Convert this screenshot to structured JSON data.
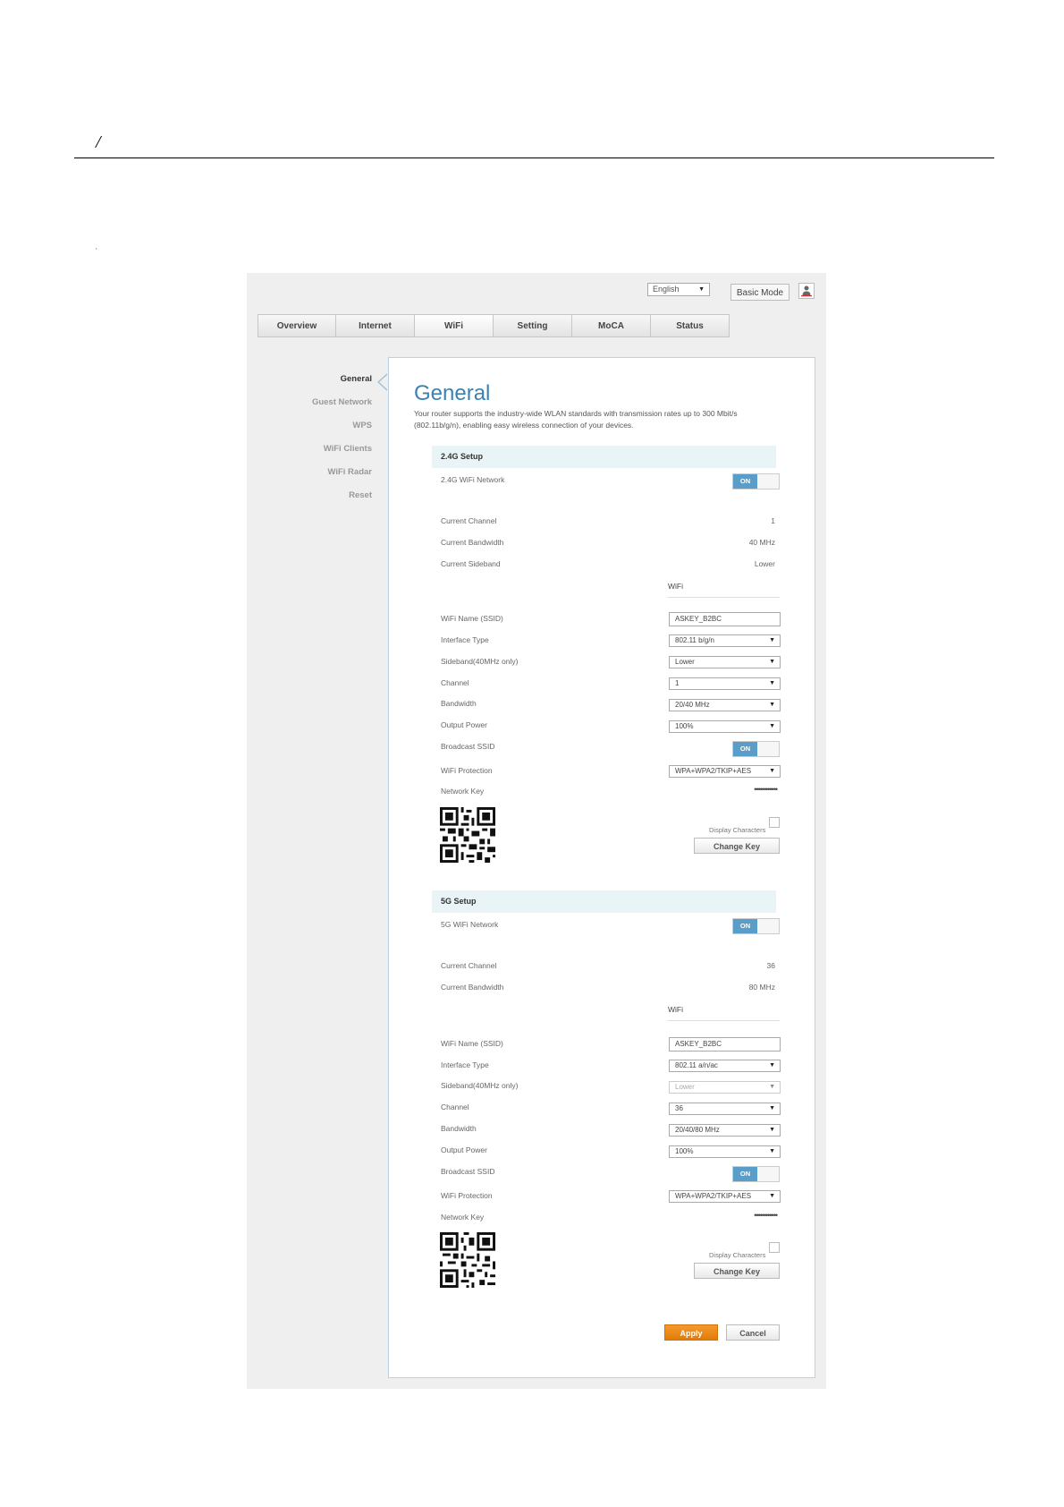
{
  "doc": {
    "mark": "/",
    "tick": "'"
  },
  "header": {
    "language": "English",
    "basic_mode": "Basic Mode",
    "user_icon": "user-icon"
  },
  "tabs": [
    {
      "label": "Overview"
    },
    {
      "label": "Internet"
    },
    {
      "label": "WiFi"
    },
    {
      "label": "Setting"
    },
    {
      "label": "MoCA"
    },
    {
      "label": "Status"
    }
  ],
  "active_tab": "WiFi",
  "sidebar": {
    "items": [
      {
        "label": "General"
      },
      {
        "label": "Guest Network"
      },
      {
        "label": "WPS"
      },
      {
        "label": "WiFi Clients"
      },
      {
        "label": "WiFi Radar"
      },
      {
        "label": "Reset"
      }
    ],
    "active": "General"
  },
  "main": {
    "title": "General",
    "description": "Your router supports the industry-wide WLAN standards with transmission rates up to 300 Mbit/s (802.11b/g/n), enabling easy wireless connection of your devices."
  },
  "band24": {
    "header": "2.4G Setup",
    "network_label": "2.4G WiFi Network",
    "network_toggle": "ON",
    "current_channel_label": "Current Channel",
    "current_channel": "1",
    "current_bandwidth_label": "Current Bandwidth",
    "current_bandwidth": "40 MHz",
    "current_sideband_label": "Current Sideband",
    "current_sideband": "Lower",
    "wifi_subheader": "WiFi",
    "ssid_label": "WiFi Name (SSID)",
    "ssid": "ASKEY_B2BC",
    "interface_label": "Interface Type",
    "interface": "802.11 b/g/n",
    "sideband_label": "Sideband(40MHz only)",
    "sideband": "Lower",
    "channel_label": "Channel",
    "channel": "1",
    "bandwidth_label": "Bandwidth",
    "bandwidth": "20/40 MHz",
    "power_label": "Output Power",
    "power": "100%",
    "broadcast_label": "Broadcast SSID",
    "broadcast_toggle": "ON",
    "protection_label": "WiFi Protection",
    "protection": "WPA+WPA2/TKIP+AES",
    "key_label": "Network Key",
    "key_mask": "••••••••••••",
    "display_chars": "Display Characters",
    "change_key": "Change Key"
  },
  "band5": {
    "header": "5G Setup",
    "network_label": "5G WiFi Network",
    "network_toggle": "ON",
    "current_channel_label": "Current Channel",
    "current_channel": "36",
    "current_bandwidth_label": "Current Bandwidth",
    "current_bandwidth": "80 MHz",
    "wifi_subheader": "WiFi",
    "ssid_label": "WiFi Name (SSID)",
    "ssid": "ASKEY_B2BC",
    "interface_label": "Interface Type",
    "interface": "802.11 a/n/ac",
    "sideband_label": "Sideband(40MHz only)",
    "sideband": "Lower",
    "channel_label": "Channel",
    "channel": "36",
    "bandwidth_label": "Bandwidth",
    "bandwidth": "20/40/80 MHz",
    "power_label": "Output Power",
    "power": "100%",
    "broadcast_label": "Broadcast SSID",
    "broadcast_toggle": "ON",
    "protection_label": "WiFi Protection",
    "protection": "WPA+WPA2/TKIP+AES",
    "key_label": "Network Key",
    "key_mask": "••••••••••••",
    "display_chars": "Display Characters",
    "change_key": "Change Key"
  },
  "footer": {
    "apply": "Apply",
    "cancel": "Cancel"
  },
  "colors": {
    "accent": "#3b82b4",
    "toggle_on": "#5a9dc9",
    "apply": "#e9870f",
    "section_bg": "#e8f4f6"
  }
}
